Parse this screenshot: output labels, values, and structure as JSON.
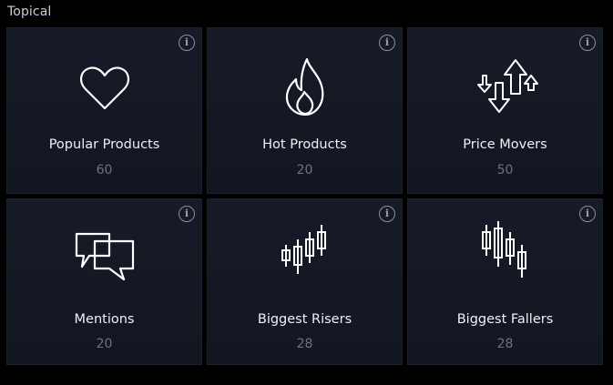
{
  "section": {
    "title": "Topical",
    "info_glyph": "i",
    "cards": [
      {
        "label": "Popular Products",
        "count": "60",
        "icon": "heart-icon"
      },
      {
        "label": "Hot Products",
        "count": "20",
        "icon": "flame-icon"
      },
      {
        "label": "Price Movers",
        "count": "50",
        "icon": "up-down-arrows-icon"
      },
      {
        "label": "Mentions",
        "count": "20",
        "icon": "chat-bubbles-icon"
      },
      {
        "label": "Biggest Risers",
        "count": "28",
        "icon": "candlestick-rising-icon"
      },
      {
        "label": "Biggest Fallers",
        "count": "28",
        "icon": "candlestick-falling-icon"
      }
    ]
  },
  "colors": {
    "background": "#000000",
    "card": "#151a25",
    "text": "#eef1f6",
    "muted": "#6d737e",
    "icon": "#ffffff"
  }
}
